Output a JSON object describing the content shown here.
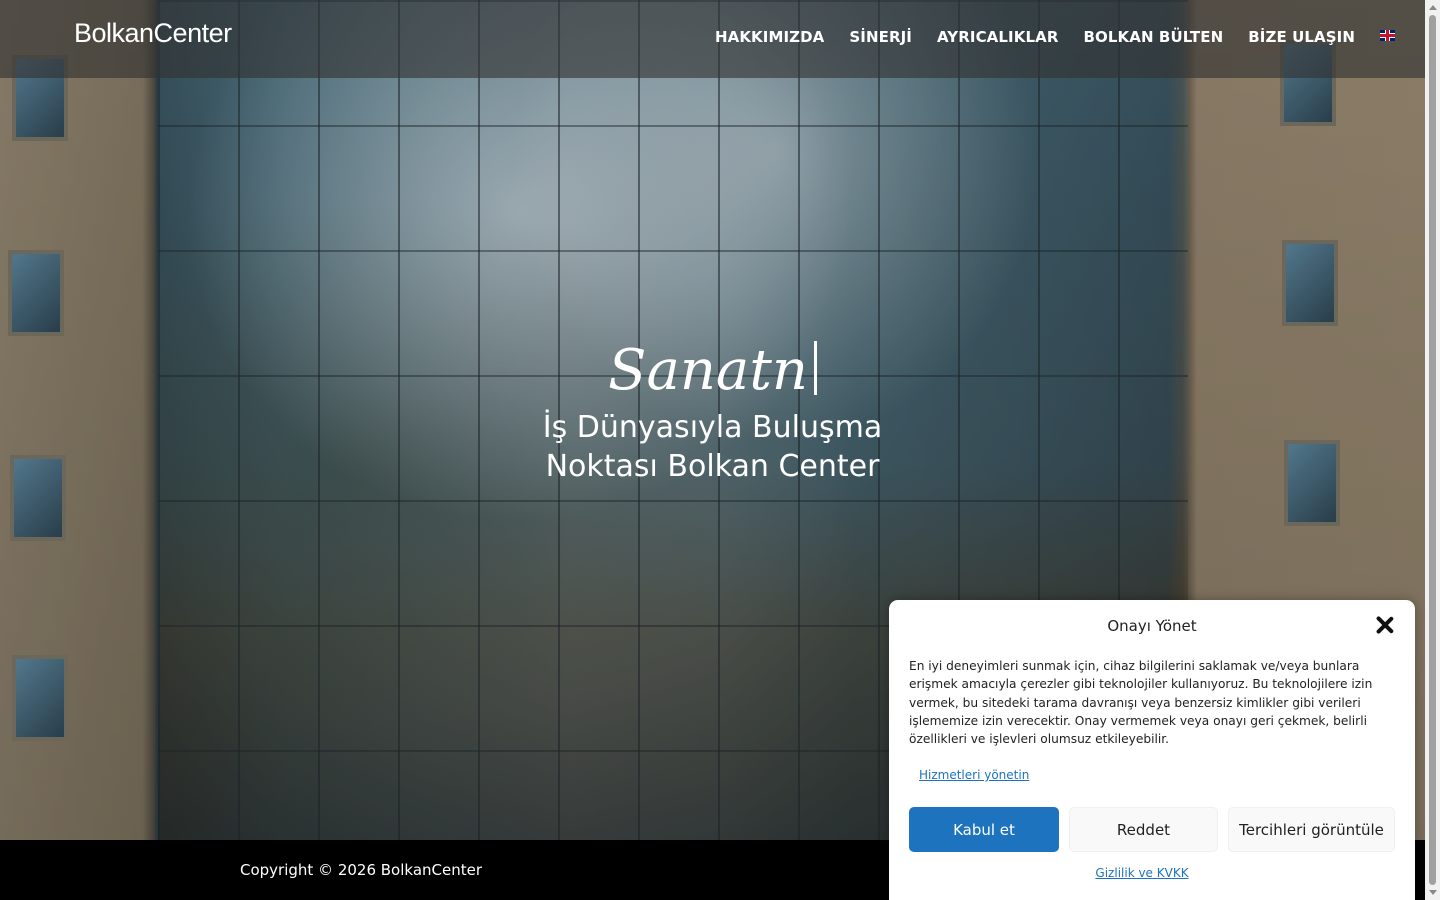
{
  "header": {
    "logo": "BolkanCenter",
    "nav": [
      "HAKKIMIZDA",
      "SİNERJİ",
      "AYRICALIKLAR",
      "BOLKAN BÜLTEN",
      "BİZE ULAŞIN"
    ],
    "language_flag": "uk-flag-icon"
  },
  "hero": {
    "title": "Sanatn",
    "subtitle_line1": "İş Dünyasıyla Buluşma",
    "subtitle_line2": "Noktası Bolkan Center"
  },
  "footer": {
    "copyright": "Copyright © 2026 BolkanCenter"
  },
  "consent": {
    "title": "Onayı Yönet",
    "text": "En iyi deneyimleri sunmak için, cihaz bilgilerini saklamak ve/veya bunlara erişmek amacıyla çerezler gibi teknolojiler kullanıyoruz. Bu teknolojilere izin vermek, bu sitedeki tarama davranışı veya benzersiz kimlikler gibi verileri işlememize izin verecektir. Onay vermemek veya onayı geri çekmek, belirli özellikleri ve işlevleri olumsuz etkileyebilir.",
    "manage_link": "Hizmetleri yönetin",
    "accept": "Kabul et",
    "reject": "Reddet",
    "preferences": "Tercihleri görüntüle",
    "privacy_link": "Gizlilik ve KVKK"
  },
  "colors": {
    "accent": "#1e73be",
    "header_bg": "#323232",
    "footer_bg": "#000000"
  }
}
